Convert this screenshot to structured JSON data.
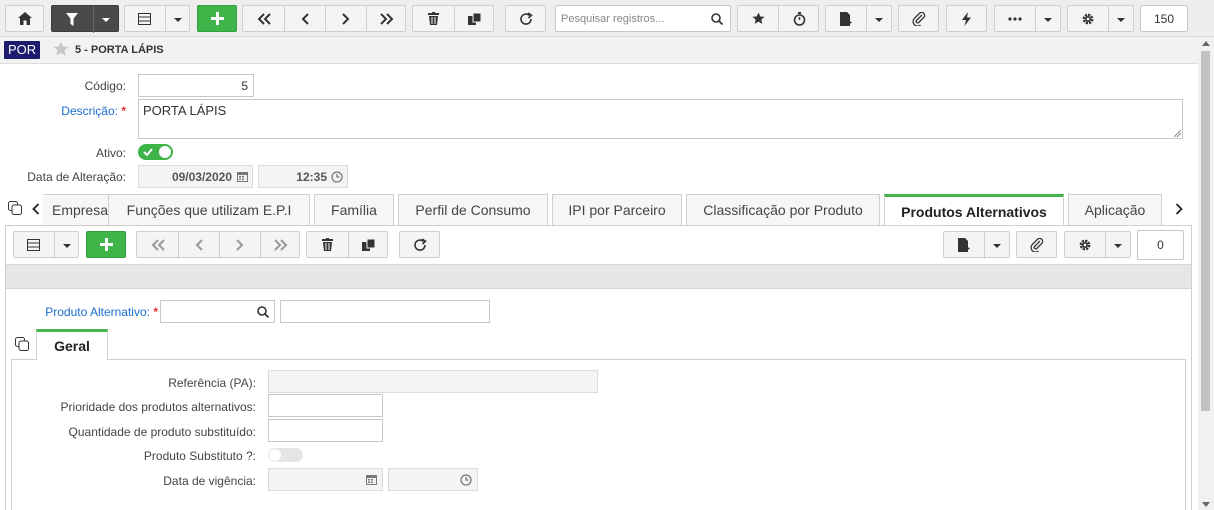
{
  "toolbar": {
    "search_placeholder": "Pesquisar registros...",
    "count": "150"
  },
  "titlebar": {
    "module_badge": "POR",
    "title": "5 - PORTA LÁPIS"
  },
  "form": {
    "codigo_label": "Código:",
    "codigo_value": "5",
    "descricao_label": "Descrição:",
    "descricao_value": "PORTA LÁPIS",
    "ativo_label": "Ativo:",
    "data_alteracao_label": "Data de Alteração:",
    "data_alteracao_date": "09/03/2020",
    "data_alteracao_time": "12:35"
  },
  "tabs": [
    {
      "label": "Empresa"
    },
    {
      "label": "Funções que utilizam E.P.I"
    },
    {
      "label": "Família"
    },
    {
      "label": "Perfil de Consumo"
    },
    {
      "label": "IPI por Parceiro"
    },
    {
      "label": "Classificação por Produto"
    },
    {
      "label": "Produtos Alternativos"
    },
    {
      "label": "Aplicação"
    }
  ],
  "subtoolbar": {
    "count": "0"
  },
  "detail": {
    "produto_alternativo_label": "Produto Alternativo:",
    "inner_tab": "Geral",
    "referencia_label": "Referência (PA):",
    "prioridade_label": "Prioridade dos produtos alternativos:",
    "quantidade_label": "Quantidade de produto substituído:",
    "substituto_label": "Produto Substituto ?:",
    "vigencia_label": "Data de vigência:"
  },
  "colors": {
    "accent_green": "#3fb449",
    "link_blue": "#1a6fd1",
    "badge_navy": "#1c1c6e",
    "required_red": "#e0312b"
  }
}
